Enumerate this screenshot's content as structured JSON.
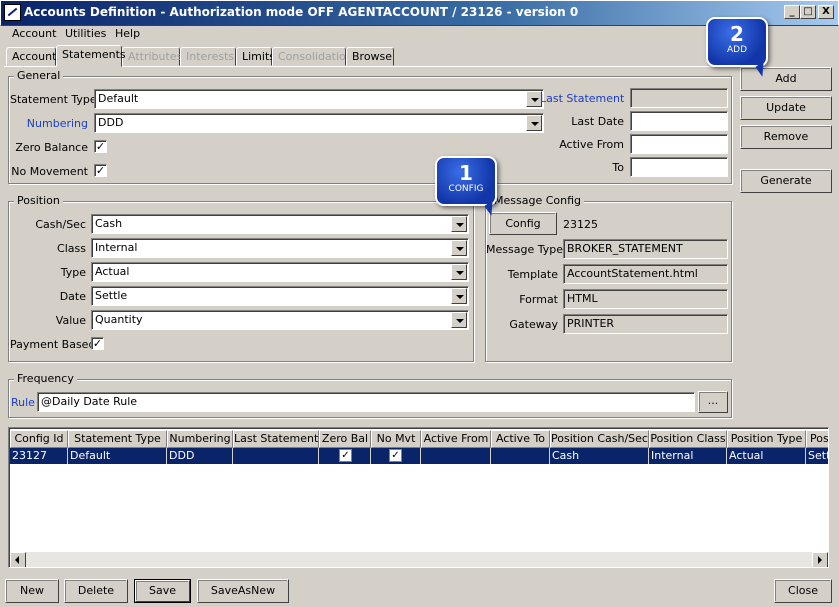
{
  "window": {
    "title": "Accounts Definition - Authorization mode OFF AGENTACCOUNT / 23126 - version 0",
    "minimize_label": "_",
    "maximize_label": "□",
    "close_label": "X"
  },
  "menu": {
    "items": [
      "Account",
      "Utilities",
      "Help"
    ]
  },
  "tabs": [
    {
      "label": "Account",
      "state": "normal"
    },
    {
      "label": "Statements",
      "state": "active"
    },
    {
      "label": "Attributes",
      "state": "disabled"
    },
    {
      "label": "Interests",
      "state": "disabled"
    },
    {
      "label": "Limits",
      "state": "normal"
    },
    {
      "label": "Consolidation",
      "state": "disabled"
    },
    {
      "label": "Browse",
      "state": "normal"
    }
  ],
  "general": {
    "title": "General",
    "statement_type_label": "Statement Type",
    "statement_type_value": "Default",
    "numbering_label": "Numbering",
    "numbering_value": "DDD",
    "zero_balance_label": "Zero Balance",
    "zero_balance_checked": "✓",
    "no_movement_label": "No Movement",
    "no_movement_checked": "✓",
    "last_statement_label": "Last Statement",
    "last_statement_value": "",
    "last_date_label": "Last Date",
    "last_date_value": "",
    "active_from_label": "Active From",
    "active_from_value": "",
    "to_label": "To",
    "to_value": ""
  },
  "position": {
    "title": "Position",
    "cash_sec_label": "Cash/Sec",
    "cash_sec_value": "Cash",
    "class_label": "Class",
    "class_value": "Internal",
    "type_label": "Type",
    "type_value": "Actual",
    "date_label": "Date",
    "date_value": "Settle",
    "value_label": "Value",
    "value_value": "Quantity",
    "payment_based_label": "Payment Based",
    "payment_based_checked": "✓"
  },
  "message_config": {
    "title": "Message Config",
    "config_button": "Config",
    "config_value": "23125",
    "message_type_label": "Message Type",
    "message_type_value": "BROKER_STATEMENT",
    "template_label": "Template",
    "template_value": "AccountStatement.html",
    "format_label": "Format",
    "format_value": "HTML",
    "gateway_label": "Gateway",
    "gateway_value": "PRINTER"
  },
  "frequency": {
    "title": "Frequency",
    "rule_label": "Rule",
    "rule_value": "@Daily Date Rule",
    "browse_button": "..."
  },
  "side_buttons": {
    "add": "Add",
    "update": "Update",
    "remove": "Remove",
    "generate": "Generate"
  },
  "grid": {
    "columns": [
      "Config Id",
      "Statement Type",
      "Numbering",
      "Last Statement",
      "Zero Bal",
      "No Mvt",
      "Active From",
      "Active To",
      "Position Cash/Sec",
      "Position Class",
      "Position Type",
      "Posit"
    ],
    "rows": [
      {
        "config_id": "23127",
        "statement_type": "Default",
        "numbering": "DDD",
        "last_statement": "",
        "zero_bal": "✓",
        "no_mvt": "✓",
        "active_from": "",
        "active_to": "",
        "position_cash_sec": "Cash",
        "position_class": "Internal",
        "position_type": "Actual",
        "posit": "Settle"
      }
    ]
  },
  "bottom_buttons": {
    "new": "New",
    "delete": "Delete",
    "save": "Save",
    "save_as_new": "SaveAsNew",
    "close": "Close"
  },
  "callouts": [
    {
      "number": "1",
      "caption": "CONFIG"
    },
    {
      "number": "2",
      "caption": "ADD"
    }
  ]
}
